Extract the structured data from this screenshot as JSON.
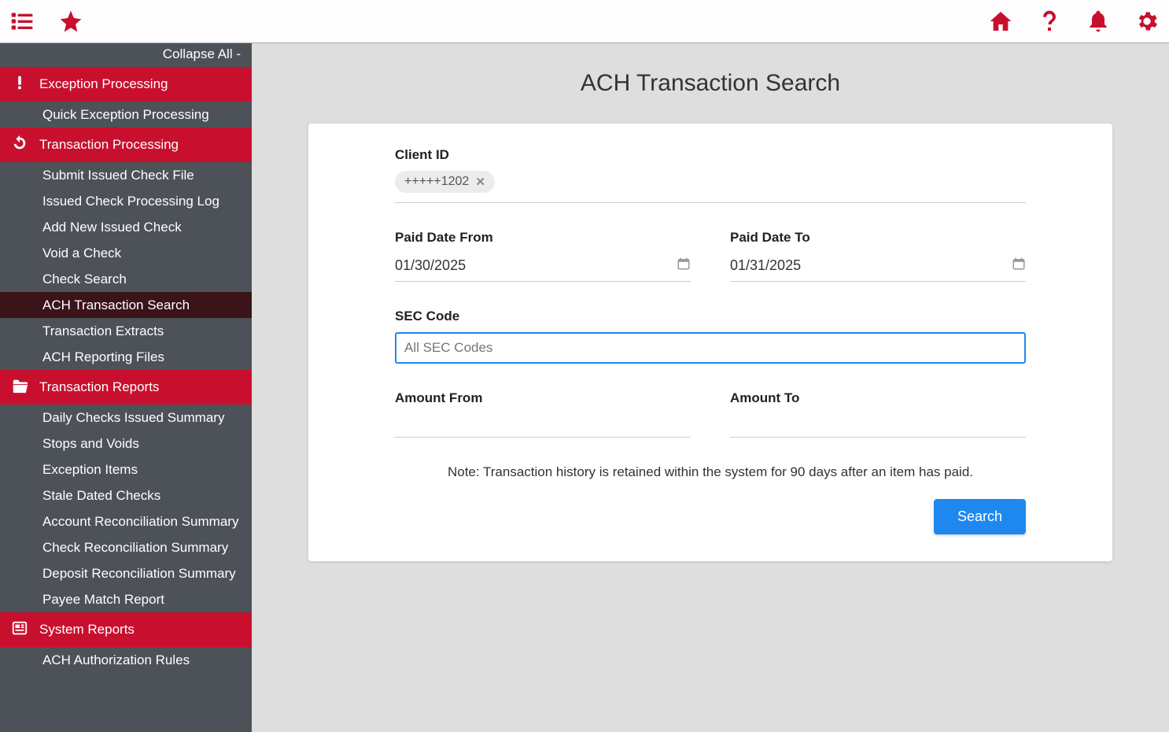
{
  "topbar": {
    "icons_left": [
      "list",
      "star"
    ],
    "icons_right": [
      "home",
      "help",
      "bell",
      "gear"
    ]
  },
  "sidebar": {
    "collapse_label": "Collapse All -",
    "groups": [
      {
        "title": "Exception Processing",
        "icon": "exclaim",
        "items": [
          "Quick Exception Processing"
        ]
      },
      {
        "title": "Transaction Processing",
        "icon": "refresh",
        "items": [
          "Submit Issued Check File",
          "Issued Check Processing Log",
          "Add New Issued Check",
          "Void a Check",
          "Check Search",
          "ACH Transaction Search",
          "Transaction Extracts",
          "ACH Reporting Files"
        ],
        "active_index": 5
      },
      {
        "title": "Transaction Reports",
        "icon": "folder",
        "items": [
          "Daily Checks Issued Summary",
          "Stops and Voids",
          "Exception Items",
          "Stale Dated Checks",
          "Account Reconciliation Summary",
          "Check Reconciliation Summary",
          "Deposit Reconciliation Summary",
          "Payee Match Report"
        ]
      },
      {
        "title": "System Reports",
        "icon": "newspaper",
        "items": [
          "ACH Authorization Rules"
        ]
      }
    ]
  },
  "page": {
    "title": "ACH Transaction Search",
    "client_id_label": "Client ID",
    "client_chip": "+++++1202",
    "paid_from_label": "Paid Date From",
    "paid_from_value": "01/30/2025",
    "paid_to_label": "Paid Date To",
    "paid_to_value": "01/31/2025",
    "sec_label": "SEC Code",
    "sec_placeholder": "All SEC Codes",
    "amount_from_label": "Amount From",
    "amount_to_label": "Amount To",
    "note": "Note: Transaction history is retained within the system for 90 days after an item has paid.",
    "search_button": "Search"
  }
}
